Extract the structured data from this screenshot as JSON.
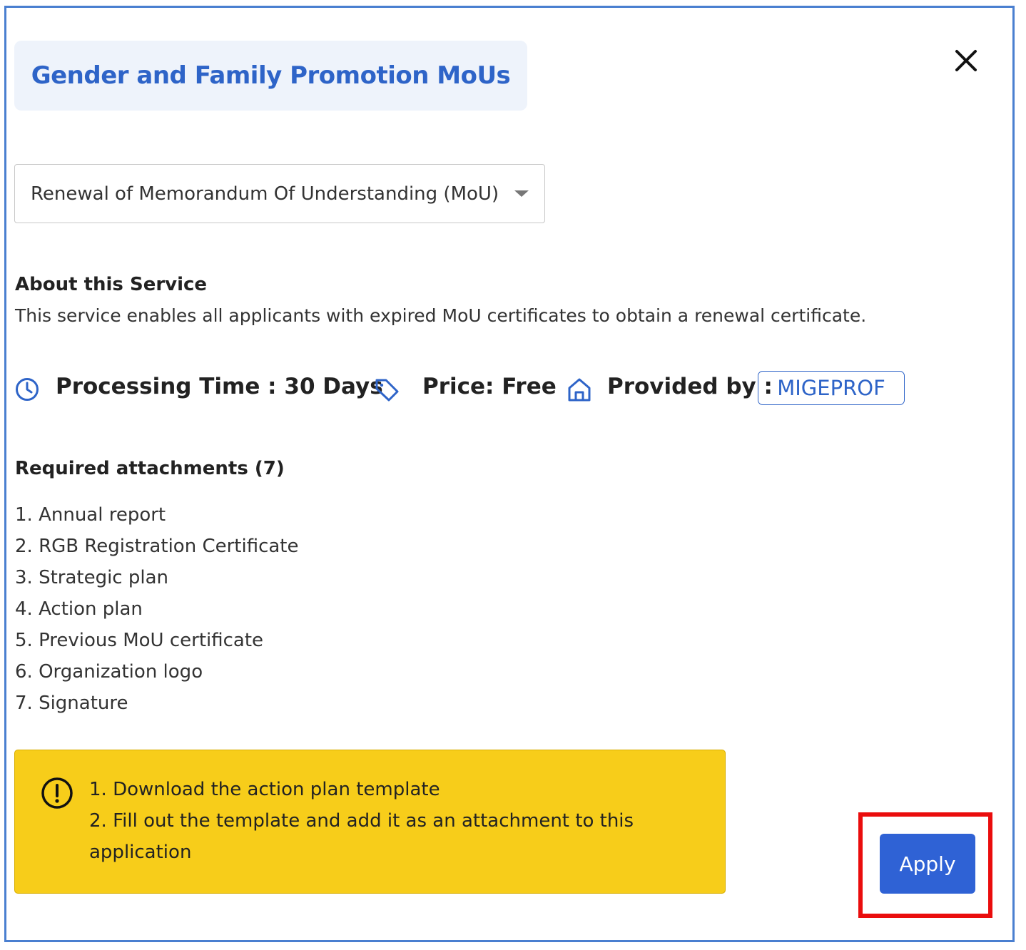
{
  "dialog": {
    "title": "Gender and Family Promotion MoUs",
    "close_icon": "close-icon"
  },
  "service_select": {
    "selected_value": "Renewal of Memorandum Of Understanding (MoU)",
    "caret_icon": "caret-down-icon"
  },
  "about": {
    "heading": "About this Service",
    "description": "This service enables all applicants with expired MoU certificates to obtain a renewal certificate."
  },
  "meta": {
    "processing_time": "Processing Time : 30 Days",
    "price": "Price: Free",
    "provided_by_label": "Provided by :",
    "provider": "MIGEPROF",
    "icons": [
      "clock-icon",
      "tag-icon",
      "home-icon"
    ]
  },
  "attachments": {
    "heading": "Required attachments (7)",
    "items": [
      "1. Annual report",
      "2. RGB Registration Certificate",
      "3. Strategic plan",
      "4. Action plan",
      "5. Previous MoU certificate",
      "6. Organization logo",
      "7. Signature"
    ]
  },
  "notice": {
    "icon": "alert-circle-icon",
    "lines": [
      "1. Download the action plan template",
      "2. Fill out the template and add it as an attachment to this application"
    ]
  },
  "actions": {
    "apply_label": "Apply"
  },
  "colors": {
    "accent": "#2e64c8",
    "button": "#2f62d5",
    "notice_bg": "#f7cd1a",
    "highlight": "#ea0d0d",
    "title_bg": "#eef3fb"
  }
}
